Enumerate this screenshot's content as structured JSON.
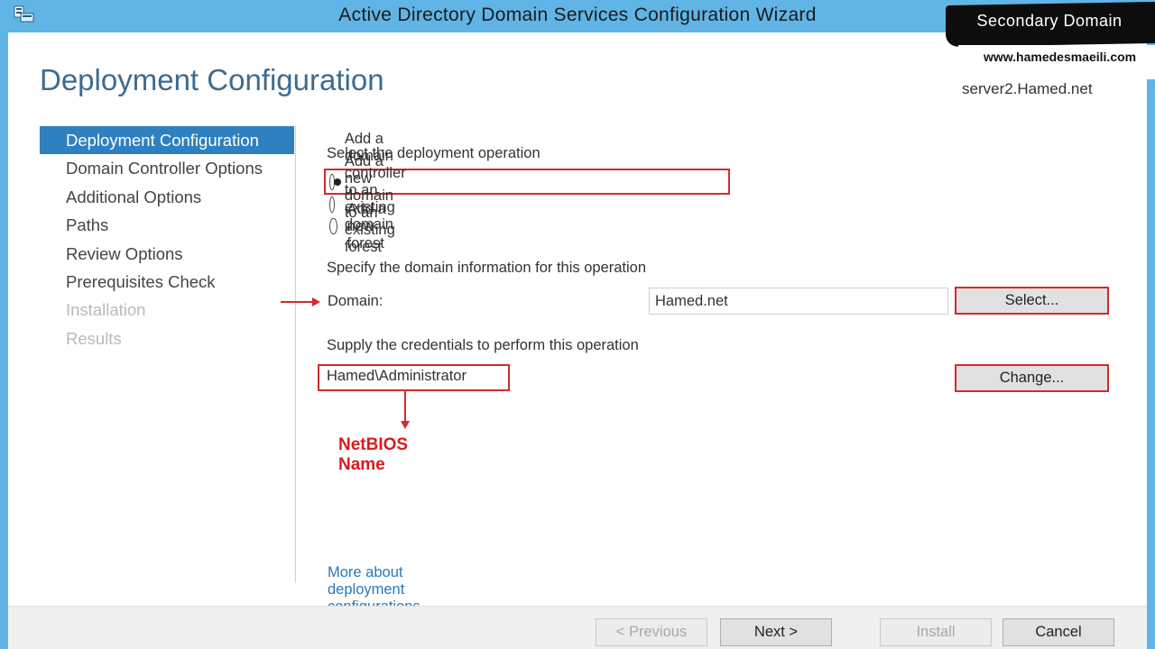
{
  "window": {
    "title": "Active Directory Domain Services Configuration Wizard"
  },
  "watermark": {
    "banner": "Secondary Domain",
    "url": "www.hamedesmaeili.com"
  },
  "header": {
    "page_title": "Deployment Configuration",
    "server_name": "server2.Hamed.net"
  },
  "nav": {
    "items": [
      {
        "label": "Deployment Configuration",
        "state": "active"
      },
      {
        "label": "Domain Controller Options",
        "state": "enabled"
      },
      {
        "label": "Additional Options",
        "state": "enabled"
      },
      {
        "label": "Paths",
        "state": "enabled"
      },
      {
        "label": "Review Options",
        "state": "enabled"
      },
      {
        "label": "Prerequisites Check",
        "state": "enabled"
      },
      {
        "label": "Installation",
        "state": "disabled"
      },
      {
        "label": "Results",
        "state": "disabled"
      }
    ]
  },
  "main": {
    "deployment_heading": "Select the deployment operation",
    "options": [
      {
        "label": "Add a domain controller to an existing domain",
        "checked": true
      },
      {
        "label": "Add a new domain to an existing forest",
        "checked": false
      },
      {
        "label": "Add a new forest",
        "checked": false
      }
    ],
    "domain_info_heading": "Specify the domain information for this operation",
    "domain_label": "Domain:",
    "domain_value": "Hamed.net",
    "select_button": "Select...",
    "credentials_heading": "Supply the credentials to perform this operation",
    "credentials_value": "Hamed\\Administrator",
    "change_button": "Change...",
    "more_link": "More about deployment configurations"
  },
  "annotations": {
    "netbios_label": "NetBIOS Name",
    "color": "#d42a2a"
  },
  "footer": {
    "previous": "< Previous",
    "next": "Next >",
    "install": "Install",
    "cancel": "Cancel"
  },
  "colors": {
    "titlebar": "#61b5e6",
    "accent": "#2e80c0",
    "page_title": "#3d6b8f",
    "link": "#2a79b8"
  }
}
